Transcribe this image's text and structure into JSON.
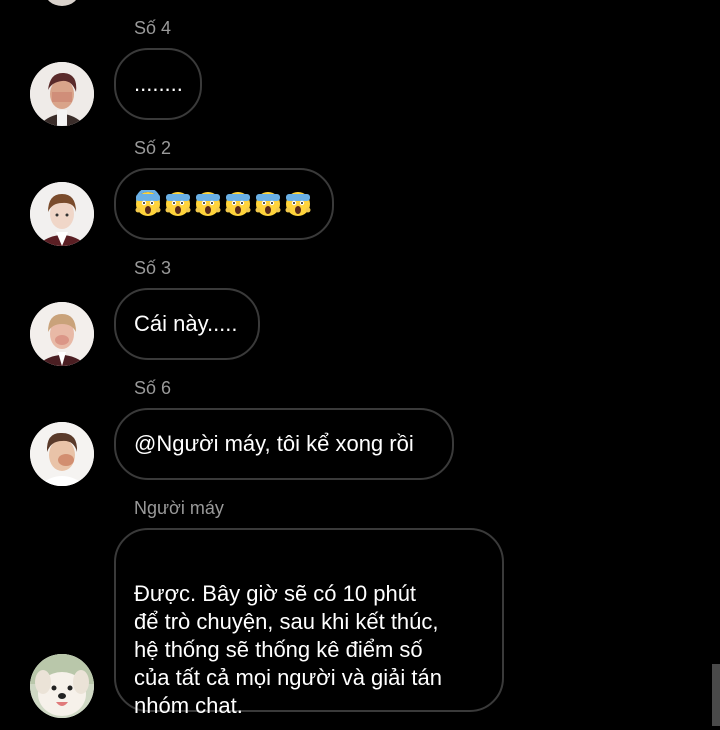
{
  "colors": {
    "background": "#000000",
    "bubble_border": "#3a3a3a",
    "sender_text": "#9a9a9a",
    "message_text": "#ffffff"
  },
  "messages": [
    {
      "sender": "Số 4",
      "text": "........",
      "avatar": "boy-avatar-4"
    },
    {
      "sender": "Số 2",
      "text": "",
      "emoji": "face-screaming-in-fear",
      "emoji_count": 6,
      "avatar": "boy-avatar-2"
    },
    {
      "sender": "Số 3",
      "text": "Cái này.....",
      "avatar": "boy-avatar-3"
    },
    {
      "sender": "Số 6",
      "text": "@Người máy, tôi kể xong rồi",
      "avatar": "boy-avatar-6"
    },
    {
      "sender": "Người máy",
      "text": "Được. Bây giờ sẽ có 10 phút\nđể trò chuyện, sau khi kết thúc,\nhệ thống sẽ thống kê điểm số\ncủa tất cả mọi người và giải tán\nnhóm chat.",
      "avatar": "dog-avatar"
    }
  ]
}
